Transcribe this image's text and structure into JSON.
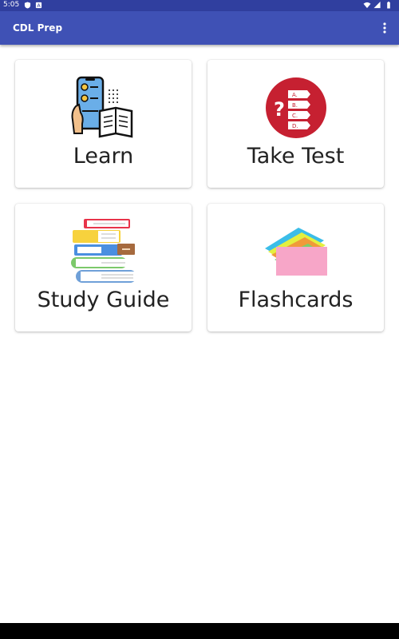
{
  "status_bar": {
    "time": "5:05"
  },
  "app_bar": {
    "title": "CDL Prep"
  },
  "cards": [
    {
      "label": "Learn",
      "icon": "phone-checklist-book-icon"
    },
    {
      "label": "Take Test",
      "icon": "test-question-icon"
    },
    {
      "label": "Study Guide",
      "icon": "book-stack-icon"
    },
    {
      "label": "Flashcards",
      "icon": "flashcards-icon"
    }
  ],
  "test_icon_options": [
    "A.",
    "B.",
    "C.",
    "D."
  ],
  "colors": {
    "status_bar": "#303f9f",
    "app_bar": "#3f51b5",
    "test_icon_red": "#c62031"
  }
}
